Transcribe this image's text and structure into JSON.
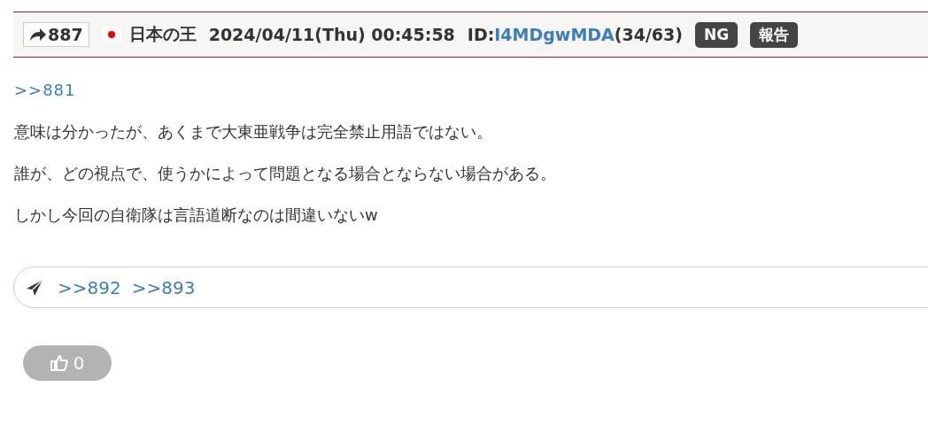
{
  "post": {
    "number": "887",
    "name": "日本の王",
    "date": "2024/04/11(Thu) 00:45:58",
    "id_label": "ID:",
    "id": "I4MDgwMDA",
    "id_count": "(34/63)",
    "buttons": [
      "NG",
      "報告"
    ]
  },
  "body": [
    {
      "kind": "link",
      "text": ">>881"
    },
    {
      "kind": "text",
      "text": "意味は分かったが、あくまで大東亜戦争は完全禁止用語ではない。"
    },
    {
      "kind": "text",
      "text": "誰が、どの視点で、使うかによって問題となる場合とならない場合がある。"
    },
    {
      "kind": "text",
      "text": "しかし今回の自衛隊は言語道断なのは間違いないw"
    }
  ],
  "replies": [
    ">>892",
    ">>893"
  ],
  "like": {
    "count": "0"
  }
}
